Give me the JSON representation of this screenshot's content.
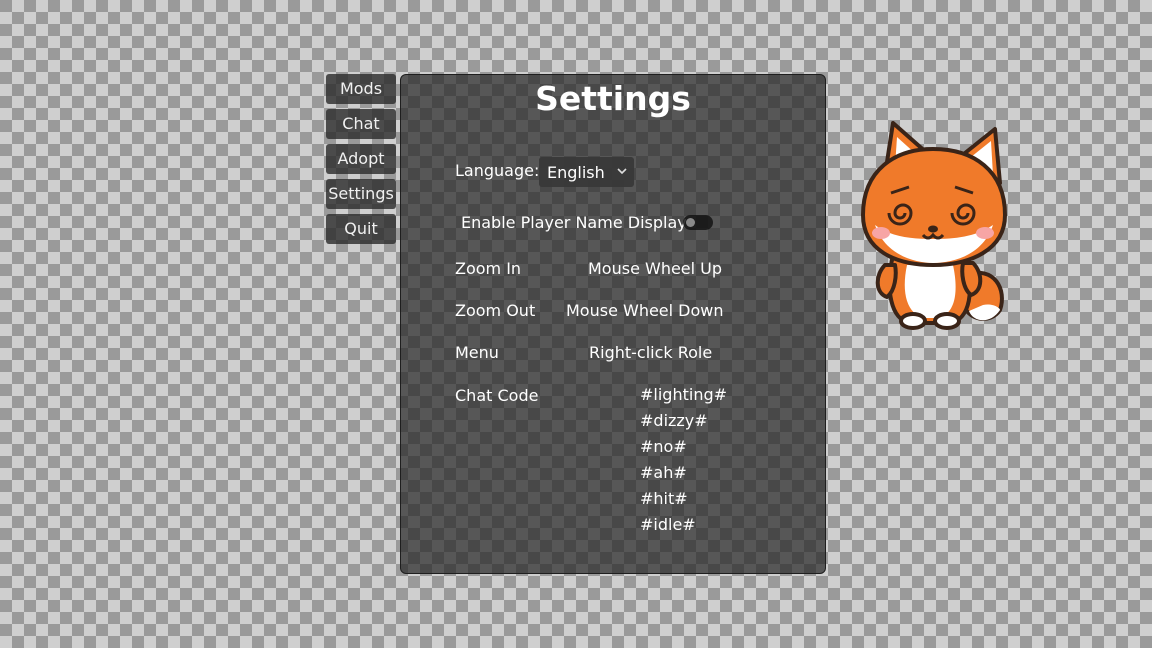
{
  "menu": {
    "items": [
      {
        "label": "Mods"
      },
      {
        "label": "Chat"
      },
      {
        "label": "Adopt"
      },
      {
        "label": "Settings"
      },
      {
        "label": "Quit"
      }
    ]
  },
  "settings": {
    "title": "Settings",
    "language": {
      "label": "Language:",
      "value": "English"
    },
    "player_name_display": {
      "label": "Enable Player Name Display",
      "enabled": false
    },
    "keybinds": [
      {
        "action": "Zoom In",
        "binding": "Mouse Wheel Up"
      },
      {
        "action": "Zoom Out",
        "binding": "Mouse Wheel Down"
      },
      {
        "action": "Menu",
        "binding": "Right-click Role"
      }
    ],
    "chat_code": {
      "label": "Chat Code",
      "codes": [
        "#lighting#",
        "#dizzy#",
        "#no#",
        "#ah#",
        "#hit#",
        "#idle#"
      ]
    }
  },
  "pet": {
    "icon": "fox-character-icon",
    "colors": {
      "fur": "#f07a2a",
      "belly": "#ffffff",
      "outline": "#3a2418"
    }
  }
}
